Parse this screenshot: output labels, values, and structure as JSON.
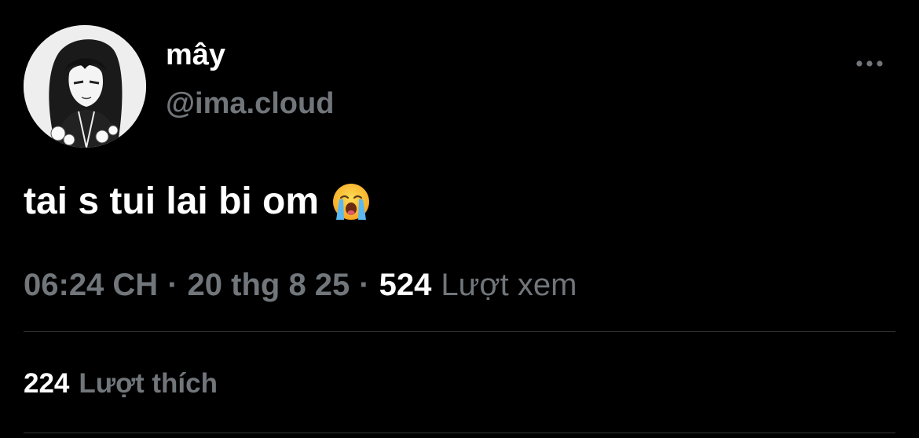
{
  "author": {
    "display_name": "mây",
    "handle": "@ima.cloud",
    "avatar_icon": "manga-avatar"
  },
  "tweet": {
    "text": "tai s tui lai bi om",
    "emoji_icon": "loudly-crying-face-icon"
  },
  "meta": {
    "time": "06:24 CH",
    "separator": "·",
    "date": "20 thg 8 25",
    "views_count": "524",
    "views_label": "Lượt xem"
  },
  "stats": {
    "likes_count": "224",
    "likes_label": "Lượt thích"
  },
  "more_icon": "more-horizontal-icon",
  "colors": {
    "background": "#000000",
    "primary_text": "#ffffff",
    "secondary_text": "#71767b",
    "divider": "#2f3336"
  }
}
